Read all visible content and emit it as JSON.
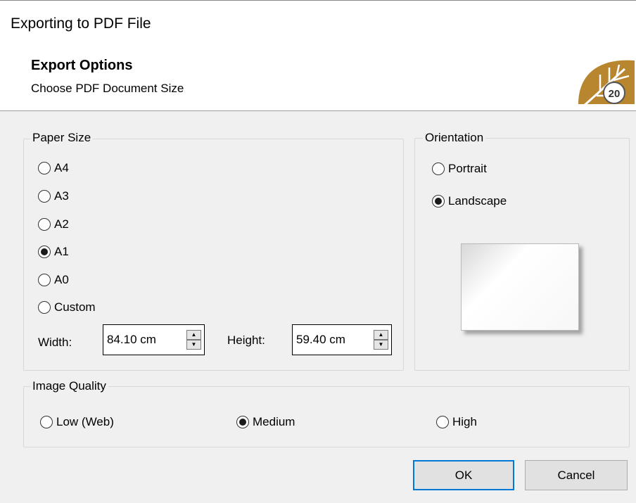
{
  "window": {
    "title": "Exporting to PDF File"
  },
  "header": {
    "title": "Export Options",
    "subtitle": "Choose PDF Document Size",
    "logo_text": "20"
  },
  "paper_size": {
    "legend": "Paper Size",
    "options": [
      "A4",
      "A3",
      "A2",
      "A1",
      "A0",
      "Custom"
    ],
    "selected": "A1",
    "width_label": "Width:",
    "width_value": "84.10 cm",
    "height_label": "Height:",
    "height_value": "59.40 cm"
  },
  "orientation": {
    "legend": "Orientation",
    "options": [
      "Portrait",
      "Landscape"
    ],
    "selected": "Landscape"
  },
  "image_quality": {
    "legend": "Image Quality",
    "options": [
      "Low (Web)",
      "Medium",
      "High"
    ],
    "selected": "Medium"
  },
  "buttons": {
    "ok": "OK",
    "cancel": "Cancel"
  },
  "colors": {
    "logo_gold": "#b8862e",
    "focus_blue": "#0078d7"
  }
}
